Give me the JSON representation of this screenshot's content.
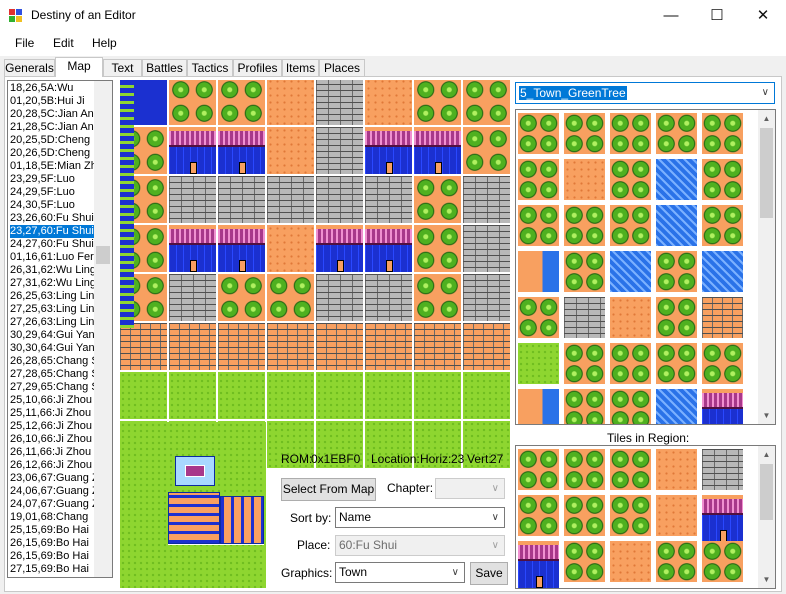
{
  "window": {
    "title": "Destiny of an Editor",
    "minimize_glyph": "—",
    "maximize_glyph": "☐",
    "close_glyph": "✕"
  },
  "menu": [
    "File",
    "Edit",
    "Help"
  ],
  "tabs": [
    {
      "label": "Generals",
      "active": false
    },
    {
      "label": "Map",
      "active": true
    },
    {
      "label": "Text",
      "active": false
    },
    {
      "label": "Battles",
      "active": false
    },
    {
      "label": "Tactics",
      "active": false
    },
    {
      "label": "Profiles",
      "active": false
    },
    {
      "label": "Items",
      "active": false
    },
    {
      "label": "Places",
      "active": false
    }
  ],
  "location_list": {
    "selected_index": 11,
    "items": [
      "18,26,5A:Wu",
      "01,20,5B:Hui Ji",
      "20,28,5C:Jian An",
      "21,28,5C:Jian An",
      "20,25,5D:Cheng",
      "20,26,5D:Cheng",
      "01,18,5E:Mian Zh",
      "23,29,5F:Luo",
      "24,29,5F:Luo",
      "24,30,5F:Luo",
      "23,26,60:Fu Shui",
      "23,27,60:Fu Shui",
      "24,27,60:Fu Shui",
      "01,16,61:Luo Fer",
      "26,31,62:Wu Ling",
      "27,31,62:Wu Ling",
      "26,25,63:Ling Lin",
      "27,25,63:Ling Lin",
      "27,26,63:Ling Lin",
      "30,29,64:Gui Yan",
      "30,30,64:Gui Yan",
      "26,28,65:Chang S",
      "27,28,65:Chang S",
      "27,29,65:Chang S",
      "25,10,66:Ji Zhou",
      "25,11,66:Ji Zhou",
      "25,12,66:Ji Zhou",
      "26,10,66:Ji Zhou",
      "26,11,66:Ji Zhou",
      "26,12,66:Ji Zhou",
      "23,06,67:Guang Z",
      "24,06,67:Guang Z",
      "24,07,67:Guang Z",
      "19,01,68:Chang",
      "25,15,69:Bo Hai",
      "26,15,69:Bo Hai",
      "26,15,69:Bo Hai",
      "27,15,69:Bo Hai"
    ]
  },
  "info": {
    "rom_label": "ROM:",
    "rom_value": "0x1EBF0",
    "location_label": "Location:",
    "horiz_label": "Horiz:",
    "horiz_value": "23",
    "vert_label": "Vert:",
    "vert_value": "27"
  },
  "controls": {
    "select_from_map": "Select From Map",
    "chapter_label": "Chapter:",
    "chapter_value": "",
    "sort_by_label": "Sort by:",
    "sort_by_value": "Name",
    "place_label": "Place:",
    "place_value": "60:Fu Shui",
    "graphics_label": "Graphics:",
    "graphics_value": "Town",
    "save": "Save"
  },
  "tileset": {
    "selected": "5_Town_GreenTree"
  },
  "tiles_in_region_label": "Tiles in Region:",
  "colors": {
    "selection": "#0078d7",
    "grass": "#8ed630",
    "dirt": "#f8a060",
    "house_blue": "#1b30d0",
    "roof": "#a8388a",
    "tree": "#4fb020"
  }
}
